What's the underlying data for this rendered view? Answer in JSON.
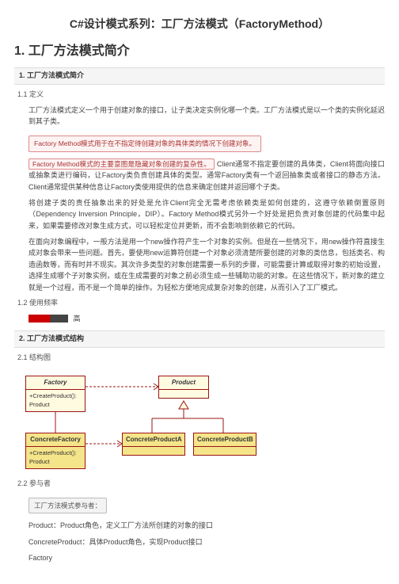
{
  "title": "C#设计模式系列：工厂方法模式（FactoryMethod）",
  "h1": "1. 工厂方法模式简介",
  "bar1": "1. 工厂方法模式简介",
  "sub11": "1.1 定义",
  "p1": "工厂方法模式定义一个用于创建对象的接口，让子类决定实例化哪一个类。工厂方法模式是以一个类的实例化延迟到其子类。",
  "redbox1": "Factory Method模式用于在不指定待创建对象的具体类的情况下创建对象。",
  "redbox2_inline": "Factory Method模式的主要意图是隐藏对象创建的复杂性。",
  "p2_after": "Client通常不指定要创建的具体类，Client将面向接口或抽象类进行编码，让Factory类负责创建具体的类型。通常Factory类有一个返回抽象类或者接口的静态方法。Client通常提供某种信息让Factory类使用提供的信息来确定创建并返回哪个子类。",
  "p3": "将创建子类的责任抽象出来的好处是允许Client完全无需考虑依赖类是如何创建的，这遵守依赖倒置原则（Dependency Inversion Principle，DIP）。Factory Method模式另外一个好处是把负责对象创建的代码集中起来，如果需要修改对象生成方式，可以轻松定位并更新，而不会影响到依赖它的代码。",
  "p4": "在面向对象编程中，一般方法是用一个new操作符产生一个对象的实例。但是在一些情况下，用new操作符直接生成对象会带来一些问题。首先，要使用new运算符创建一个对象必须清楚所要创建的对象的类信息，包括类名、构造函数等，而有时并不现实。其次许多类型的对象创建需要一系列的步骤，可能需要计算或取得对象的初始设置，选择生成哪个子对象实例，或在生成需要的对象之前必须生成一些辅助功能的对象。在这些情况下，新对象的建立就是一个过程，而不是一个简单的操作。为轻松方便地完成复杂对象的创建，从而引入了工厂模式。",
  "sub12": "1.2 使用频率",
  "freq_label": "高",
  "bar2": "2. 工厂方法模式结构",
  "sub21": "2.1 结构图",
  "uml": {
    "factory": "Factory",
    "factory_m": "+CreateProduct(): Product",
    "product": "Product",
    "concreteFactory": "ConcreteFactory",
    "cf_m": "+CreateProduct(): Product",
    "cpa": "ConcreteProductA",
    "cpb": "ConcreteProductB"
  },
  "sub22": "2.2 参与者",
  "greybox": "工厂方法模式参与者：",
  "pp1": "Product：Product角色，定义工厂方法所创建的对象的接口",
  "pp2": "ConcreteProduct：具体Product角色，实现Product接口",
  "pp3": "Factory"
}
